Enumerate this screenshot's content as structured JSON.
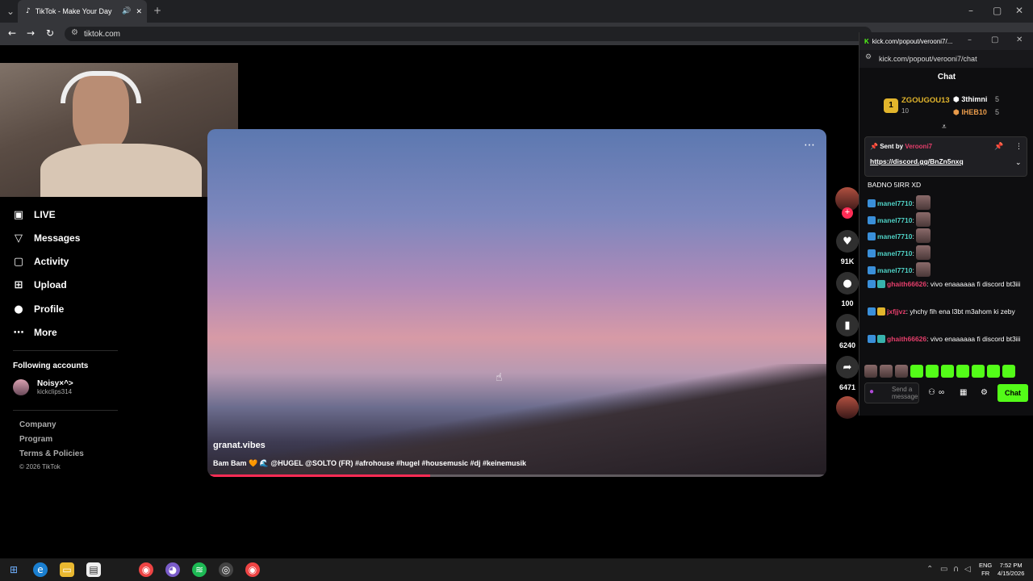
{
  "browser": {
    "tab_title": "TikTok - Make Your Day",
    "url": "tiktok.com",
    "new_tab": "+"
  },
  "sidebar": {
    "items": [
      {
        "label": "LIVE",
        "icon": "live-icon"
      },
      {
        "label": "Messages",
        "icon": "messages-icon"
      },
      {
        "label": "Activity",
        "icon": "activity-icon"
      },
      {
        "label": "Upload",
        "icon": "upload-icon"
      },
      {
        "label": "Profile",
        "icon": "profile-icon"
      },
      {
        "label": "More",
        "icon": "more-icon"
      }
    ],
    "following_title": "Following accounts",
    "following": [
      {
        "name": "Noisy×^>",
        "handle": "kickclips314"
      }
    ],
    "footer": [
      "Company",
      "Program",
      "Terms & Policies",
      "© 2026 TikTok"
    ]
  },
  "video": {
    "author": "granat.vibes",
    "caption": "Bam Bam 🧡 🌊 @HUGEL @SOLTO (FR) #afrohouse #hugel #housemusic #dj #keinemusik",
    "progress": 0.36,
    "actions": [
      {
        "icon": "heart-icon",
        "count": "91K"
      },
      {
        "icon": "comment-icon",
        "count": "100"
      },
      {
        "icon": "bookmark-icon",
        "count": "6240"
      },
      {
        "icon": "share-icon",
        "count": "6471"
      }
    ]
  },
  "popup": {
    "window_title": "kick.com/popout/verooni7/...",
    "url": "kick.com/popout/verooni7/chat",
    "header": "Chat",
    "leaderboard": {
      "first_name": "ZGOUGOU13",
      "first_count": "10",
      "second_name": "3thimni",
      "second_count": "5",
      "third_name": "IHEB10",
      "third_count": "5",
      "first_rank": "1"
    },
    "pinned": {
      "sent_by_label": "Sent by",
      "sender": "Verooni7",
      "link": "https://discord.gg/BnZn5nxq"
    },
    "messages": [
      {
        "user": "",
        "text": "BADNO 5IRR XD",
        "color": "#ffffff"
      },
      {
        "user": "manel7710",
        "text": ":",
        "color": "#4fd1c5"
      },
      {
        "user": "manel7710",
        "text": ":",
        "color": "#4fd1c5"
      },
      {
        "user": "manel7710",
        "text": ":",
        "color": "#4fd1c5"
      },
      {
        "user": "manel7710",
        "text": ":",
        "color": "#4fd1c5"
      },
      {
        "user": "manel7710",
        "text": ":",
        "color": "#4fd1c5"
      },
      {
        "user": "ghaith66626",
        "text": ": vivo enaaaaaa fi discord bt3iii",
        "color": "#e53e6b"
      },
      {
        "user": "jxfjjvz",
        "text": ": yhchy fih ena l3bt m3ahom ki zeby",
        "color": "#e53e6b"
      },
      {
        "user": "ghaith66626",
        "text": ": vivo enaaaaaa fi discord bt3iii",
        "color": "#e53e6b"
      }
    ],
    "input_placeholder": "Send a message",
    "chat_button": "Chat"
  },
  "taskbar": {
    "lang1": "ENG",
    "lang2": "FR",
    "time": "7:52 PM",
    "date": "4/15/2026"
  },
  "colors": {
    "accent": "#fe2c55",
    "kick_green": "#53fc18"
  }
}
